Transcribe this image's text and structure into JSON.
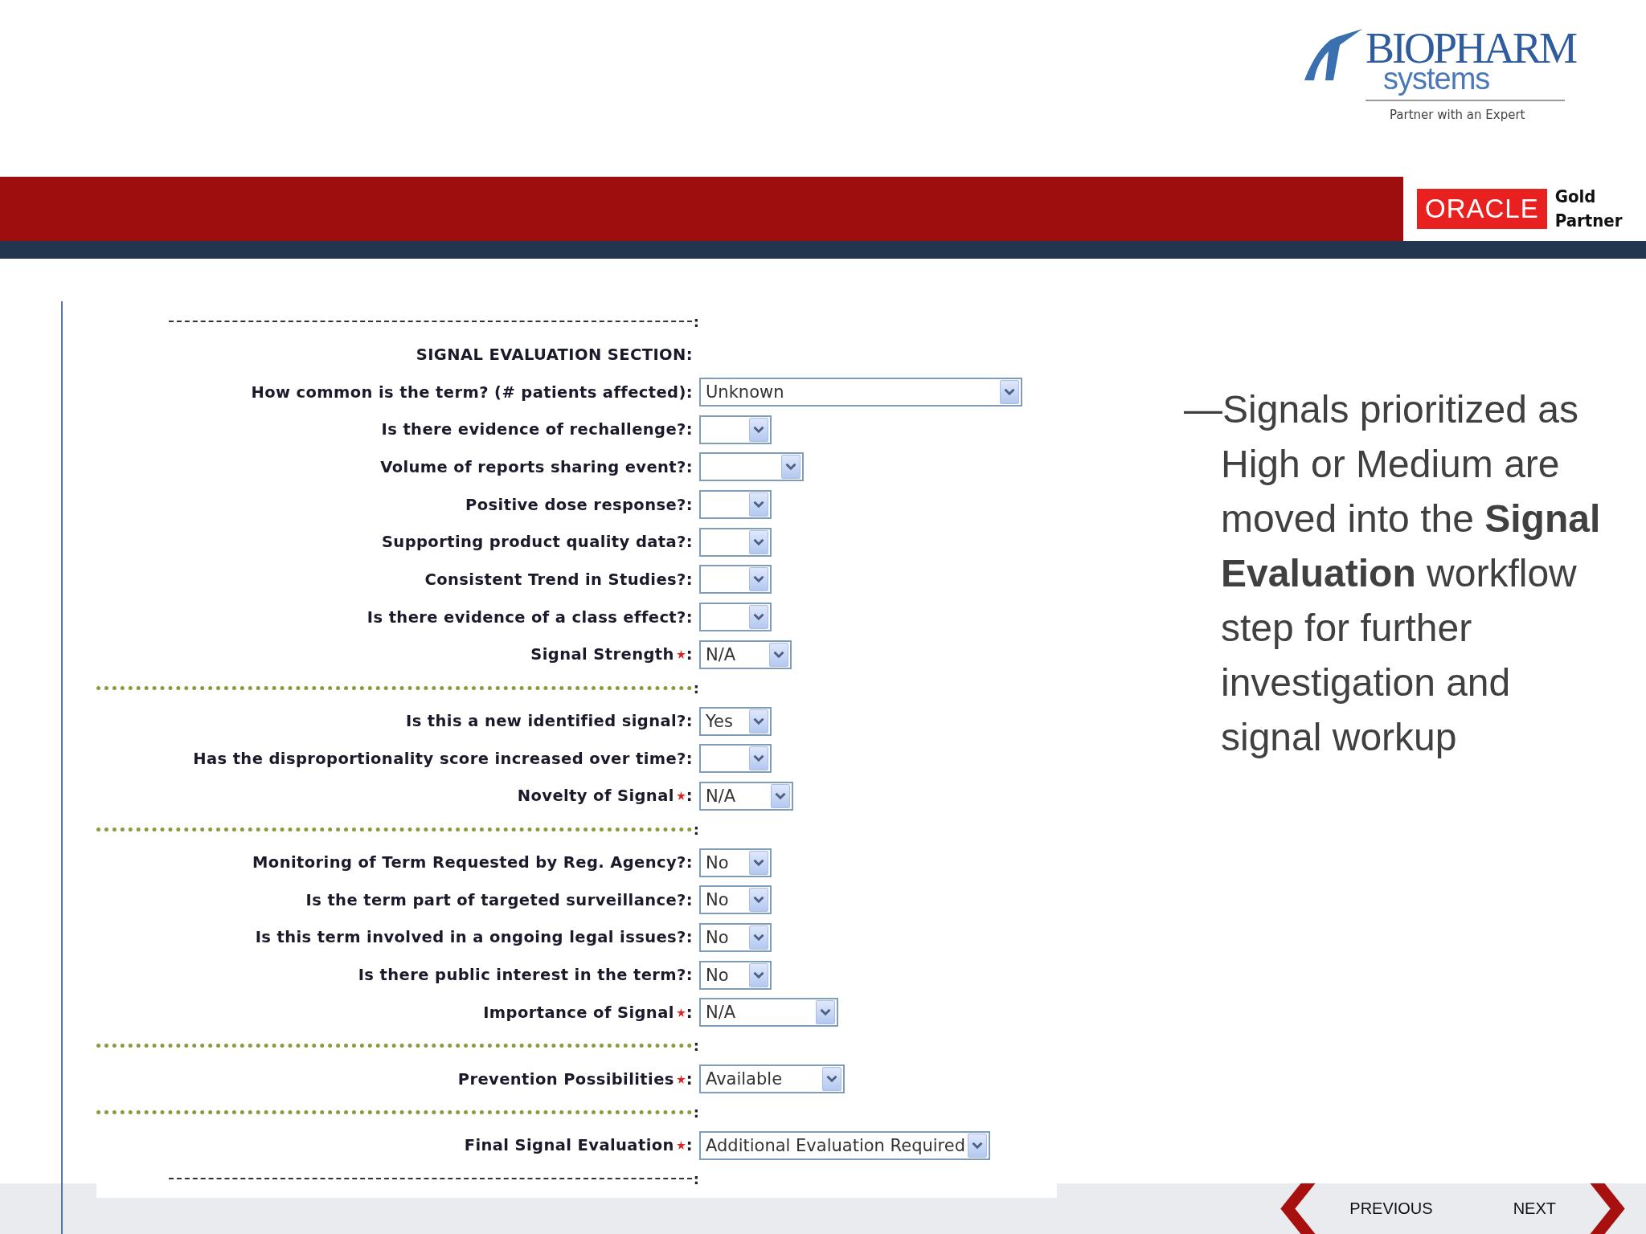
{
  "logo": {
    "name": "BIOPHARM",
    "sub": "systems",
    "tagline": "Partner with an Expert"
  },
  "partner_badge": {
    "brand": "ORACLE",
    "line_1": "Gold",
    "line_2": "Partner"
  },
  "form": {
    "rows": [
      {
        "kind": "dashes",
        "mark": ":"
      },
      {
        "kind": "title",
        "label": "SIGNAL EVALUATION SECTION:"
      },
      {
        "kind": "field",
        "label": "How common is the term? (# patients affected)",
        "required": false,
        "colon": ":",
        "value": "Unknown"
      },
      {
        "kind": "field",
        "label": "Is there evidence of rechallenge?",
        "required": false,
        "colon": ":",
        "value": ""
      },
      {
        "kind": "field",
        "label": "Volume of reports sharing event?",
        "required": false,
        "colon": ":",
        "value": ""
      },
      {
        "kind": "field",
        "label": "Positive dose response?",
        "required": false,
        "colon": ":",
        "value": ""
      },
      {
        "kind": "field",
        "label": "Supporting product quality data?",
        "required": false,
        "colon": ":",
        "value": ""
      },
      {
        "kind": "field",
        "label": "Consistent Trend in Studies?",
        "required": false,
        "colon": ":",
        "value": ""
      },
      {
        "kind": "field",
        "label": "Is there evidence of a class effect?",
        "required": false,
        "colon": ":",
        "value": ""
      },
      {
        "kind": "field",
        "label": "Signal Strength",
        "required": true,
        "colon": ":",
        "value": "N/A"
      },
      {
        "kind": "stars",
        "mark": ":"
      },
      {
        "kind": "field",
        "label": "Is this a new identified signal?",
        "required": false,
        "colon": ":",
        "value": "Yes"
      },
      {
        "kind": "field",
        "label": "Has the disproportionality score increased over time?",
        "required": false,
        "colon": ":",
        "value": ""
      },
      {
        "kind": "field",
        "label": "Novelty of Signal",
        "required": true,
        "colon": ":",
        "value": "N/A"
      },
      {
        "kind": "stars",
        "mark": ":"
      },
      {
        "kind": "field",
        "label": "Monitoring of Term Requested by Reg. Agency?",
        "required": false,
        "colon": ":",
        "value": "No"
      },
      {
        "kind": "field",
        "label": "Is the term part of targeted surveillance?",
        "required": false,
        "colon": ":",
        "value": "No"
      },
      {
        "kind": "field",
        "label": "Is this term involved in a ongoing legal issues?",
        "required": false,
        "colon": ":",
        "value": "No"
      },
      {
        "kind": "field",
        "label": "Is there public interest in the term?",
        "required": false,
        "colon": ":",
        "value": "No"
      },
      {
        "kind": "field",
        "label": "Importance of Signal",
        "required": true,
        "colon": ":",
        "value": "N/A"
      },
      {
        "kind": "stars",
        "mark": ":"
      },
      {
        "kind": "field",
        "label": "Prevention Possibilities",
        "required": true,
        "colon": ":",
        "value": "Available"
      },
      {
        "kind": "stars",
        "mark": ":"
      },
      {
        "kind": "field",
        "label": "Final Signal Evaluation",
        "required": true,
        "colon": ":",
        "value": "Additional Evaluation Required"
      },
      {
        "kind": "dashes",
        "mark": ":"
      }
    ]
  },
  "bullet": "—Signals prioritized as High or Medium are moved into the **Signal Evaluation** workflow step for further investigation and signal workup",
  "nav": {
    "previous": "PREVIOUS",
    "next": "NEXT"
  }
}
